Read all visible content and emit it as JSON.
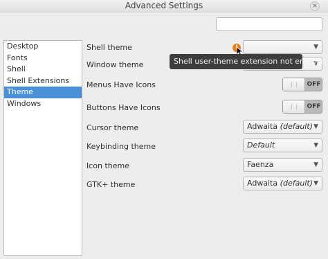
{
  "window": {
    "title": "Advanced Settings",
    "close_glyph": "×"
  },
  "search": {
    "value": ""
  },
  "sidebar": {
    "items": [
      {
        "label": "Desktop"
      },
      {
        "label": "Fonts"
      },
      {
        "label": "Shell"
      },
      {
        "label": "Shell Extensions"
      },
      {
        "label": "Theme",
        "selected": true
      },
      {
        "label": "Windows"
      }
    ]
  },
  "settings": {
    "shell_theme": {
      "label": "Shell theme",
      "value": ""
    },
    "window_theme": {
      "label": "Window theme"
    },
    "menus_have_icons": {
      "label": "Menus Have Icons",
      "state": "OFF"
    },
    "buttons_have_icons": {
      "label": "Buttons Have Icons",
      "state": "OFF"
    },
    "cursor_theme": {
      "label": "Cursor theme",
      "value": "Adwaita",
      "suffix": "(default)"
    },
    "keybinding_theme": {
      "label": "Keybinding theme",
      "value": "Default"
    },
    "icon_theme": {
      "label": "Icon theme",
      "value": "Faenza"
    },
    "gtk_theme": {
      "label": "GTK+ theme",
      "value": "Adwaita",
      "suffix": "(default)"
    }
  },
  "tooltip": {
    "text": "Shell user-theme extension not enabled"
  },
  "icons": {
    "warning": "warning-icon",
    "cursor": "mouse-pointer-icon",
    "dropdown": "chevron-down-icon"
  },
  "colors": {
    "selection": "#4a90d9",
    "warning": "#e8801a",
    "tooltip_bg": "#3d3d3d"
  }
}
